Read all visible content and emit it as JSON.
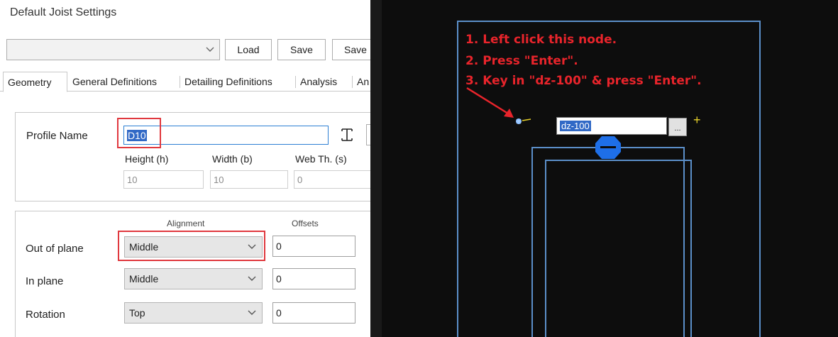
{
  "dialog": {
    "title": "Default Joist Settings",
    "preset_combo": {
      "value": ""
    },
    "buttons": {
      "load": "Load",
      "save": "Save",
      "save_as": "Save"
    },
    "tabs": [
      {
        "label": "Geometry",
        "active": true
      },
      {
        "label": "General Definitions",
        "active": false
      },
      {
        "label": "Detailing Definitions",
        "active": false
      },
      {
        "label": "Analysis",
        "active": false
      },
      {
        "label": "An",
        "active": false
      }
    ],
    "profile": {
      "label": "Profile Name",
      "value": "D10",
      "height_label": "Height (h)",
      "height_value": "10",
      "width_label": "Width (b)",
      "width_value": "10",
      "web_label": "Web Th. (s)",
      "web_value": "0"
    },
    "alignment": {
      "alignment_header": "Alignment",
      "offsets_header": "Offsets",
      "rows": [
        {
          "label": "Out of plane",
          "value": "Middle",
          "offset": "0"
        },
        {
          "label": "In plane",
          "value": "Middle",
          "offset": "0"
        },
        {
          "label": "Rotation",
          "value": "Top",
          "offset": "0"
        }
      ]
    }
  },
  "cad": {
    "instructions": [
      "1. Left click this node.",
      "2. Press \"Enter\".",
      "3. Key in \"dz-100\" & press \"Enter\"."
    ],
    "command_input": "dz-100",
    "browse_label": "...",
    "colors": {
      "background": "#0d0d0d",
      "lines": "#5b8fc9",
      "annotation": "#e8242b",
      "node": "#1e6fe8",
      "cursor": "#e8d22b"
    }
  },
  "icons": [
    "chevron-down-icon",
    "i-beam-icon",
    "node-icon",
    "plus-cursor-icon",
    "arrow-annotation"
  ]
}
